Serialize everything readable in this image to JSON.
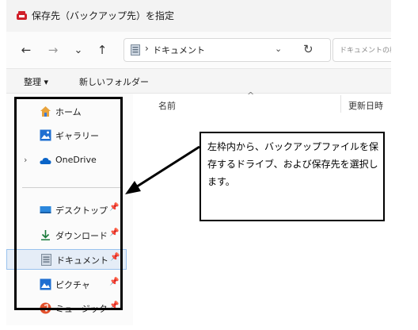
{
  "window": {
    "title": "保存先（バックアップ先）を指定"
  },
  "navigation": {
    "back_glyph": "←",
    "forward_glyph": "→",
    "recent_glyph": "⌄",
    "up_glyph": "↑",
    "address_separator": "›",
    "address_text": "ドキュメント",
    "address_dropdown_glyph": "⌄",
    "refresh_glyph": "↻",
    "search_placeholder": "ドキュメントの検"
  },
  "command_bar": {
    "organize": "整理 ▾",
    "new_folder": "新しいフォルダー"
  },
  "sidebar": {
    "items": [
      {
        "label": "ホーム",
        "icon": "home-icon"
      },
      {
        "label": "ギャラリー",
        "icon": "gallery-icon"
      },
      {
        "label": "OneDrive",
        "icon": "cloud-icon",
        "chevron": "›"
      },
      {
        "label": "デスクトップ",
        "icon": "desktop-icon",
        "pin": "📌"
      },
      {
        "label": "ダウンロード",
        "icon": "download-icon",
        "pin": "📌"
      },
      {
        "label": "ドキュメント",
        "icon": "document-icon",
        "pin": "📌",
        "selected": true
      },
      {
        "label": "ピクチャ",
        "icon": "pictures-icon",
        "pin": "📌"
      },
      {
        "label": "ミュージック",
        "icon": "music-icon",
        "pin": "📌"
      }
    ]
  },
  "file_list": {
    "col_name": "名前",
    "col_date": "更新日時",
    "sort_glyph": "^"
  },
  "annotation": {
    "text": "左枠内から、バックアップファイルを保存するドライブ、および保存先を選択します。"
  },
  "colors": {
    "accent": "#0067c0",
    "selection_bg": "#e5edf7",
    "annotation_border": "#000000"
  }
}
